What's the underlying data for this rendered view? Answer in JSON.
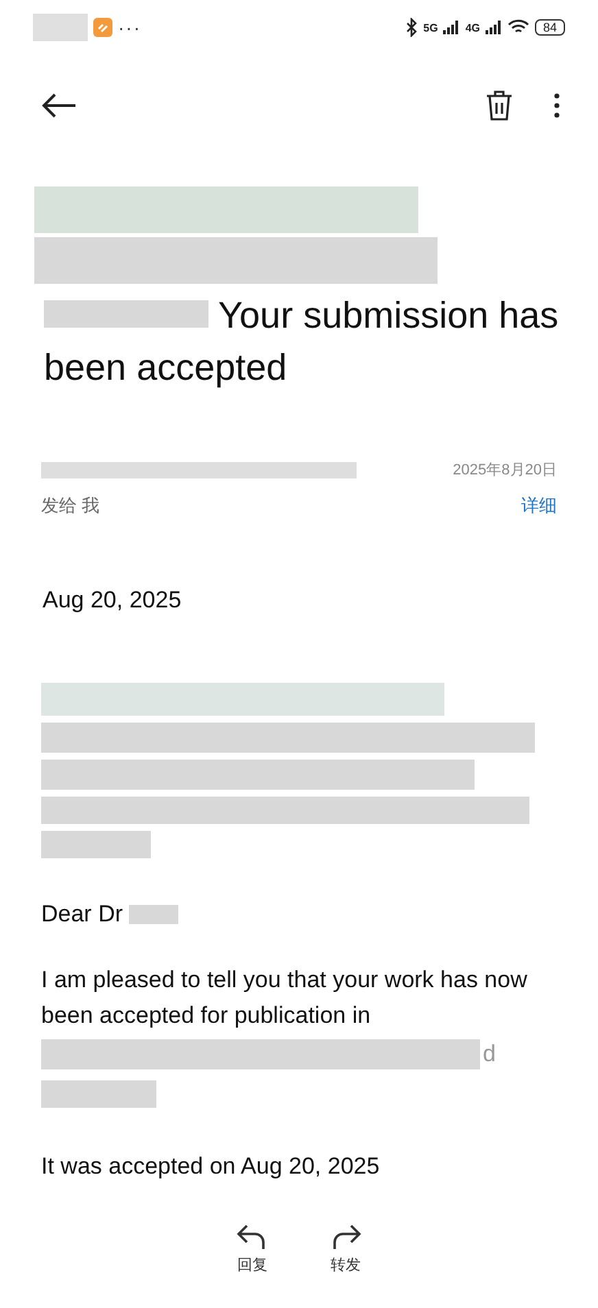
{
  "status_bar": {
    "more": "···",
    "battery": "84",
    "network_1": "5G",
    "network_2": "4G"
  },
  "subject": "Your submission has been accepted",
  "sender": {
    "recipient": "发给 我",
    "date": "2025年8月20日",
    "details_link": "详细"
  },
  "body": {
    "date": "Aug 20, 2025",
    "greeting": "Dear Dr",
    "paragraph": "I am pleased to tell you that your work has now been accepted for publication in",
    "fragment": "d",
    "closing": "It was accepted on Aug 20, 2025"
  },
  "actions": [
    {
      "kind": "reply",
      "label": "回复"
    },
    {
      "kind": "forward",
      "label": "转发"
    }
  ]
}
